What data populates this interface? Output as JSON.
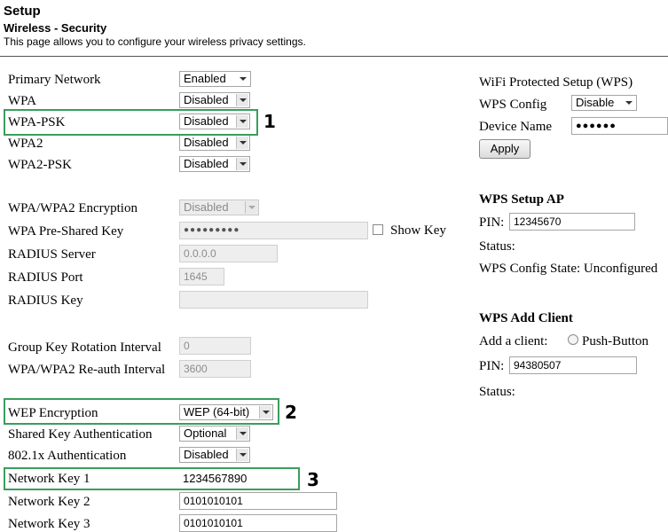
{
  "header": {
    "title": "Setup",
    "subtitle": "Wireless - Security",
    "description": "This page allows you to configure your wireless privacy settings."
  },
  "left": {
    "primary_network": {
      "label": "Primary Network",
      "value": "Enabled"
    },
    "wpa": {
      "label": "WPA",
      "value": "Disabled"
    },
    "wpa_psk": {
      "label": "WPA-PSK",
      "value": "Disabled"
    },
    "wpa2": {
      "label": "WPA2",
      "value": "Disabled"
    },
    "wpa2_psk": {
      "label": "WPA2-PSK",
      "value": "Disabled"
    },
    "encryption": {
      "label": "WPA/WPA2 Encryption",
      "value": "Disabled"
    },
    "psk": {
      "label": "WPA Pre-Shared Key",
      "value": "●●●●●●●●●",
      "show_key": "Show Key"
    },
    "radius_server": {
      "label": "RADIUS Server",
      "value": "0.0.0.0"
    },
    "radius_port": {
      "label": "RADIUS Port",
      "value": "1645"
    },
    "radius_key": {
      "label": "RADIUS Key",
      "value": ""
    },
    "group_key": {
      "label": "Group Key Rotation Interval",
      "value": "0"
    },
    "reauth": {
      "label": "WPA/WPA2 Re-auth Interval",
      "value": "3600"
    },
    "wep_enc": {
      "label": "WEP Encryption",
      "value": "WEP (64-bit)"
    },
    "shared_key": {
      "label": "Shared Key Authentication",
      "value": "Optional"
    },
    "auth_8021x": {
      "label": "802.1x Authentication",
      "value": "Disabled"
    },
    "net_key1": {
      "label": "Network Key 1",
      "value": "1234567890"
    },
    "net_key2": {
      "label": "Network Key 2",
      "value": "0101010101"
    },
    "net_key3": {
      "label": "Network Key 3",
      "value": "0101010101"
    }
  },
  "right": {
    "wps_title": "WiFi Protected Setup (WPS)",
    "wps_config": {
      "label": "WPS Config",
      "value": "Disable"
    },
    "device_name": {
      "label": "Device Name",
      "value": "●●●●●●"
    },
    "apply": "Apply",
    "setup_ap": {
      "title": "WPS Setup AP",
      "pin_label": "PIN:",
      "pin": "12345670",
      "status_label": "Status:",
      "config_state": "WPS Config State: Unconfigured"
    },
    "add_client": {
      "title": "WPS Add Client",
      "label": "Add a client:",
      "push_button": "Push-Button",
      "pin_label": "PIN:",
      "pin": "94380507",
      "status_label": "Status:"
    }
  },
  "annotations": {
    "n1": "1",
    "n2": "2",
    "n3": "3"
  },
  "colors": {
    "highlight": "#3a9d5d",
    "text": "#000000"
  }
}
